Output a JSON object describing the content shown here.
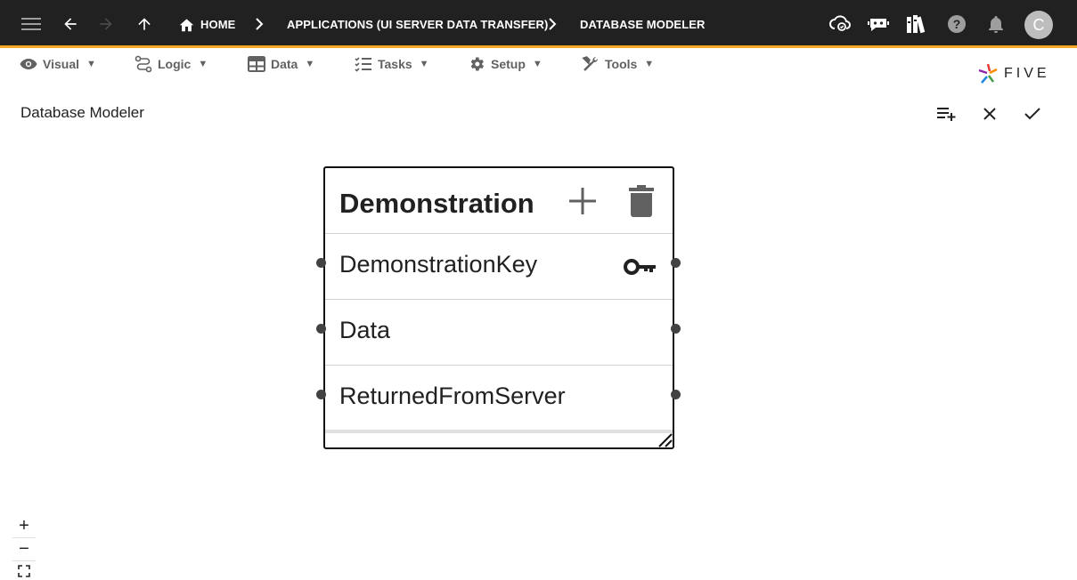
{
  "topbar": {
    "breadcrumbs": [
      "HOME",
      "APPLICATIONS (UI SERVER DATA TRANSFER)",
      "DATABASE MODELER"
    ],
    "avatar_initial": "C"
  },
  "menu": {
    "items": [
      {
        "label": "Visual",
        "icon": "eye-icon"
      },
      {
        "label": "Logic",
        "icon": "logic-icon"
      },
      {
        "label": "Data",
        "icon": "table-icon"
      },
      {
        "label": "Tasks",
        "icon": "checklist-icon"
      },
      {
        "label": "Setup",
        "icon": "gear-icon"
      },
      {
        "label": "Tools",
        "icon": "tools-icon"
      }
    ],
    "caret": "▼"
  },
  "logo": {
    "text": "FIVE"
  },
  "page": {
    "title": "Database Modeler"
  },
  "entity": {
    "title": "Demonstration",
    "fields": [
      {
        "name": "DemonstrationKey",
        "primary_key": true
      },
      {
        "name": "Data",
        "primary_key": false
      },
      {
        "name": "ReturnedFromServer",
        "primary_key": false
      }
    ]
  },
  "zoom": {
    "in": "+",
    "out": "−"
  },
  "colors": {
    "topbar": "#212121",
    "accent": "#f5a623",
    "menu_text": "#616161"
  }
}
